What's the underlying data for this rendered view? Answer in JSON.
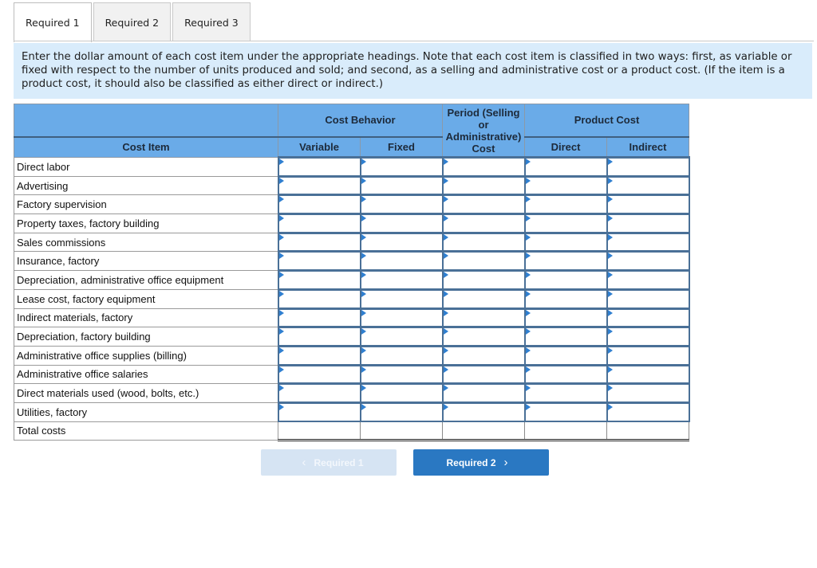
{
  "tabs": [
    {
      "label": "Required 1",
      "active": true
    },
    {
      "label": "Required 2",
      "active": false
    },
    {
      "label": "Required 3",
      "active": false
    }
  ],
  "instructions": "Enter the dollar amount of each cost item under the appropriate headings. Note that each cost item is classified in two ways: first, as variable or fixed with respect to the number of units produced and sold; and second, as a selling and administrative cost or a product cost. (If the item is a product cost, it should also be classified as either direct or indirect.)",
  "table": {
    "group_headers": {
      "cost_behavior": "Cost Behavior",
      "period": "Period (Selling or Administrative) Cost",
      "product_cost": "Product Cost"
    },
    "period_lines": [
      "Period (Selling",
      "or",
      "Administrative)",
      "Cost"
    ],
    "columns": {
      "cost_item": "Cost Item",
      "variable": "Variable",
      "fixed": "Fixed",
      "direct": "Direct",
      "indirect": "Indirect"
    },
    "rows": [
      "Direct labor",
      "Advertising",
      "Factory supervision",
      "Property taxes, factory building",
      "Sales commissions",
      "Insurance, factory",
      "Depreciation, administrative office equipment",
      "Lease cost, factory equipment",
      "Indirect materials, factory",
      "Depreciation, factory building",
      "Administrative office supplies (billing)",
      "Administrative office salaries",
      "Direct materials used (wood, bolts, etc.)",
      "Utilities, factory"
    ],
    "total_label": "Total costs"
  },
  "nav": {
    "prev_label": "Required 1",
    "next_label": "Required 2",
    "prev_icon": "chevron-left-icon",
    "next_icon": "chevron-right-icon"
  },
  "colors": {
    "header_bg": "#6aabe8",
    "instructions_bg": "#d9ecfb",
    "next_button": "#2a78c2",
    "prev_button_disabled": "#d6e4f3",
    "input_border": "#4a7097"
  }
}
